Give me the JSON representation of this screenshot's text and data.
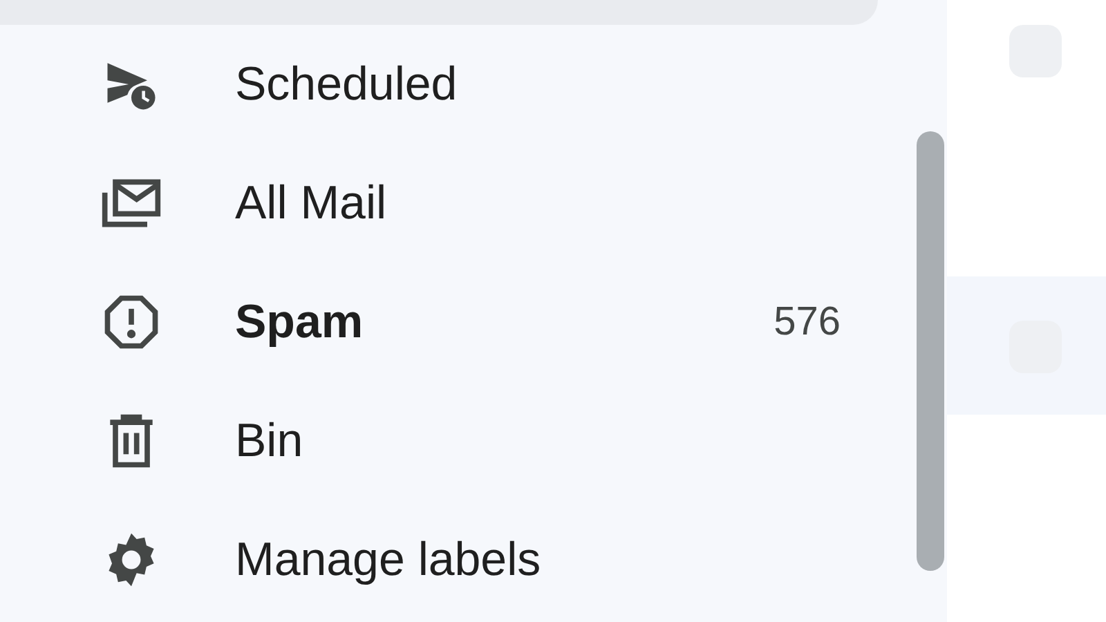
{
  "drawer": {
    "items": [
      {
        "kind": "scheduled",
        "label": "Scheduled",
        "unread": false
      },
      {
        "kind": "all-mail",
        "label": "All Mail",
        "unread": false
      },
      {
        "kind": "spam",
        "label": "Spam",
        "unread": true,
        "count": "576"
      },
      {
        "kind": "bin",
        "label": "Bin",
        "unread": false
      },
      {
        "kind": "labels",
        "label": "Manage labels",
        "unread": false
      }
    ]
  }
}
